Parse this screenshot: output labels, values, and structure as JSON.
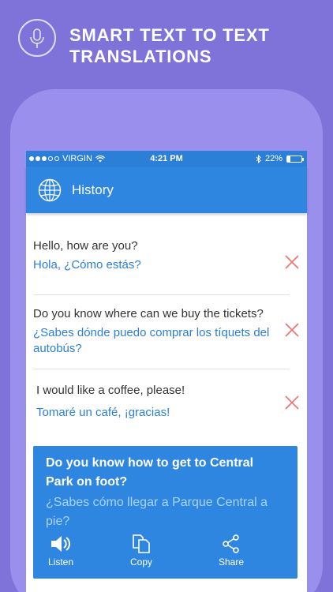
{
  "promo": {
    "headline_line1": "SMART TEXT TO TEXT",
    "headline_line2": "TRANSLATIONS",
    "icon": "microphone-icon"
  },
  "statusbar": {
    "carrier": "VIRGIN",
    "time": "4:21 PM",
    "battery": "22%",
    "battery_level": 0.22
  },
  "appbar": {
    "title": "History",
    "icon": "globe-icon"
  },
  "history": [
    {
      "source": "Hello, how are you?",
      "translation": "Hola, ¿Cómo estás?"
    },
    {
      "source": "Do you know where can we buy the tickets?",
      "translation": "¿Sabes dónde puedo comprar los tíquets del autobús?"
    },
    {
      "source": "I would like a coffee, please!",
      "translation": "Tomaré un café, ¡gracias!"
    }
  ],
  "current": {
    "source": "Do you know how to get to Central Park on foot?",
    "translation": "¿Sabes cómo llegar a Parque Central a pie?",
    "actions": {
      "listen": "Listen",
      "copy": "Copy",
      "share": "Share"
    }
  },
  "colors": {
    "background": "#7f72d8",
    "device": "#9a8fec",
    "primary": "#2f86e0",
    "translation_text": "#2b7fd7",
    "delete": "#f07070"
  }
}
